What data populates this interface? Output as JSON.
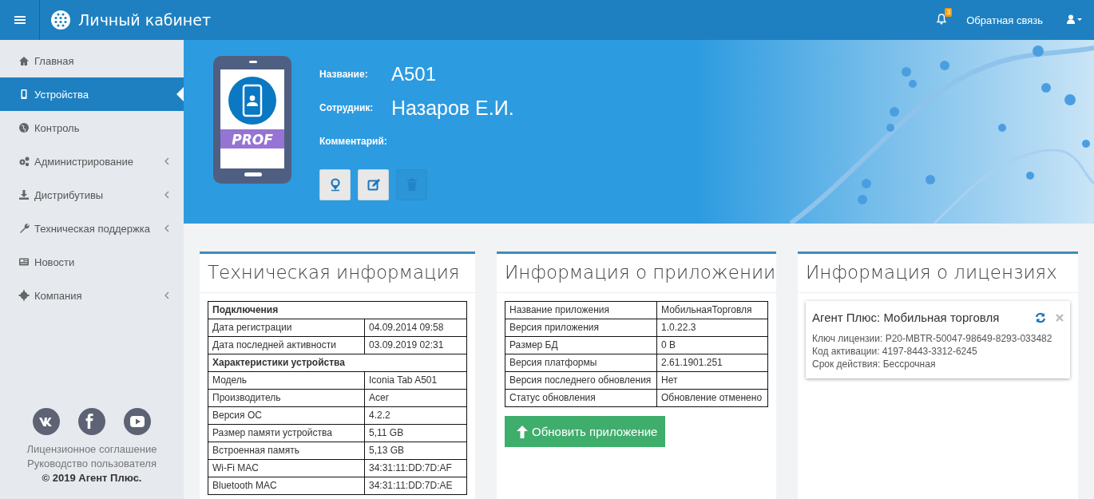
{
  "topbar": {
    "title": "Личный кабинет",
    "notifications": "3",
    "feedback": "Обратная связь"
  },
  "sidebar": {
    "items": [
      {
        "label": "Главная",
        "selected": false,
        "submenu": false
      },
      {
        "label": "Устройства",
        "selected": true,
        "submenu": false
      },
      {
        "label": "Контроль",
        "selected": false,
        "submenu": false
      },
      {
        "label": "Администрирование",
        "selected": false,
        "submenu": true
      },
      {
        "label": "Дистрибутивы",
        "selected": false,
        "submenu": true
      },
      {
        "label": "Техническая поддержка",
        "selected": false,
        "submenu": true
      },
      {
        "label": "Новости",
        "selected": false,
        "submenu": false
      },
      {
        "label": "Компания",
        "selected": false,
        "submenu": true
      }
    ],
    "links": [
      "Лицензионное соглашение",
      "Руководство пользователя"
    ],
    "copyright": "© 2019 Агент Плюс."
  },
  "device": {
    "badge": "PROF",
    "fields": [
      {
        "label": "Название:",
        "value": "A501"
      },
      {
        "label": "Сотрудник:",
        "value": "Назаров Е.И."
      },
      {
        "label": "Комментарий:"
      }
    ],
    "buttons": [
      {
        "kind": "location",
        "disabled": false
      },
      {
        "kind": "edit",
        "disabled": false
      },
      {
        "kind": "delete",
        "disabled": true
      }
    ]
  },
  "tech_info": {
    "title": "Техническая информация",
    "rows": [
      {
        "kind": "section",
        "label": "Подключения"
      },
      {
        "kind": "row",
        "label": "Дата регистрации",
        "value": "04.09.2014 09:58"
      },
      {
        "kind": "row",
        "label": "Дата последней активности",
        "value": "03.09.2019 02:31"
      },
      {
        "kind": "section",
        "label": "Характеристики устройства"
      },
      {
        "kind": "row",
        "label": "Модель",
        "value": "Iconia Tab A501"
      },
      {
        "kind": "row",
        "label": "Производитель",
        "value": "Acer"
      },
      {
        "kind": "row",
        "label": "Версия ОС",
        "value": "4.2.2"
      },
      {
        "kind": "row",
        "label": "Размер памяти устройства",
        "value": "5,11 GB"
      },
      {
        "kind": "row",
        "label": "Встроенная память",
        "value": "5,13 GB"
      },
      {
        "kind": "row",
        "label": "Wi-Fi MAC",
        "value": "34:31:11:DD:7D:AF"
      },
      {
        "kind": "row",
        "label": "Bluetooth MAC",
        "value": "34:31:11:DD:7D:AE"
      }
    ]
  },
  "app_info": {
    "title": "Информация о приложении",
    "rows": [
      {
        "label": "Название приложения",
        "value": "МобильнаяТорговля"
      },
      {
        "label": "Версия приложения",
        "value": "1.0.22.3"
      },
      {
        "label": "Размер БД",
        "value": "0 B"
      },
      {
        "label": "Версия платформы",
        "value": "2.61.1901.251"
      },
      {
        "label": "Версия последнего обновления",
        "value": "Нет"
      },
      {
        "label": "Статус обновления",
        "value": "Обновление отменено"
      }
    ],
    "button": "Обновить приложение"
  },
  "license_info": {
    "title": "Информация о лицензиях",
    "licenses": [
      {
        "name": "Агент Плюс: Мобильная торговля",
        "lines": [
          "Ключ лицензии: P20-MBTR-50047-98649-8293-033482",
          "Код активации: 4197-8443-3312-6245",
          "Срок действия: Бессрочная"
        ]
      }
    ]
  }
}
